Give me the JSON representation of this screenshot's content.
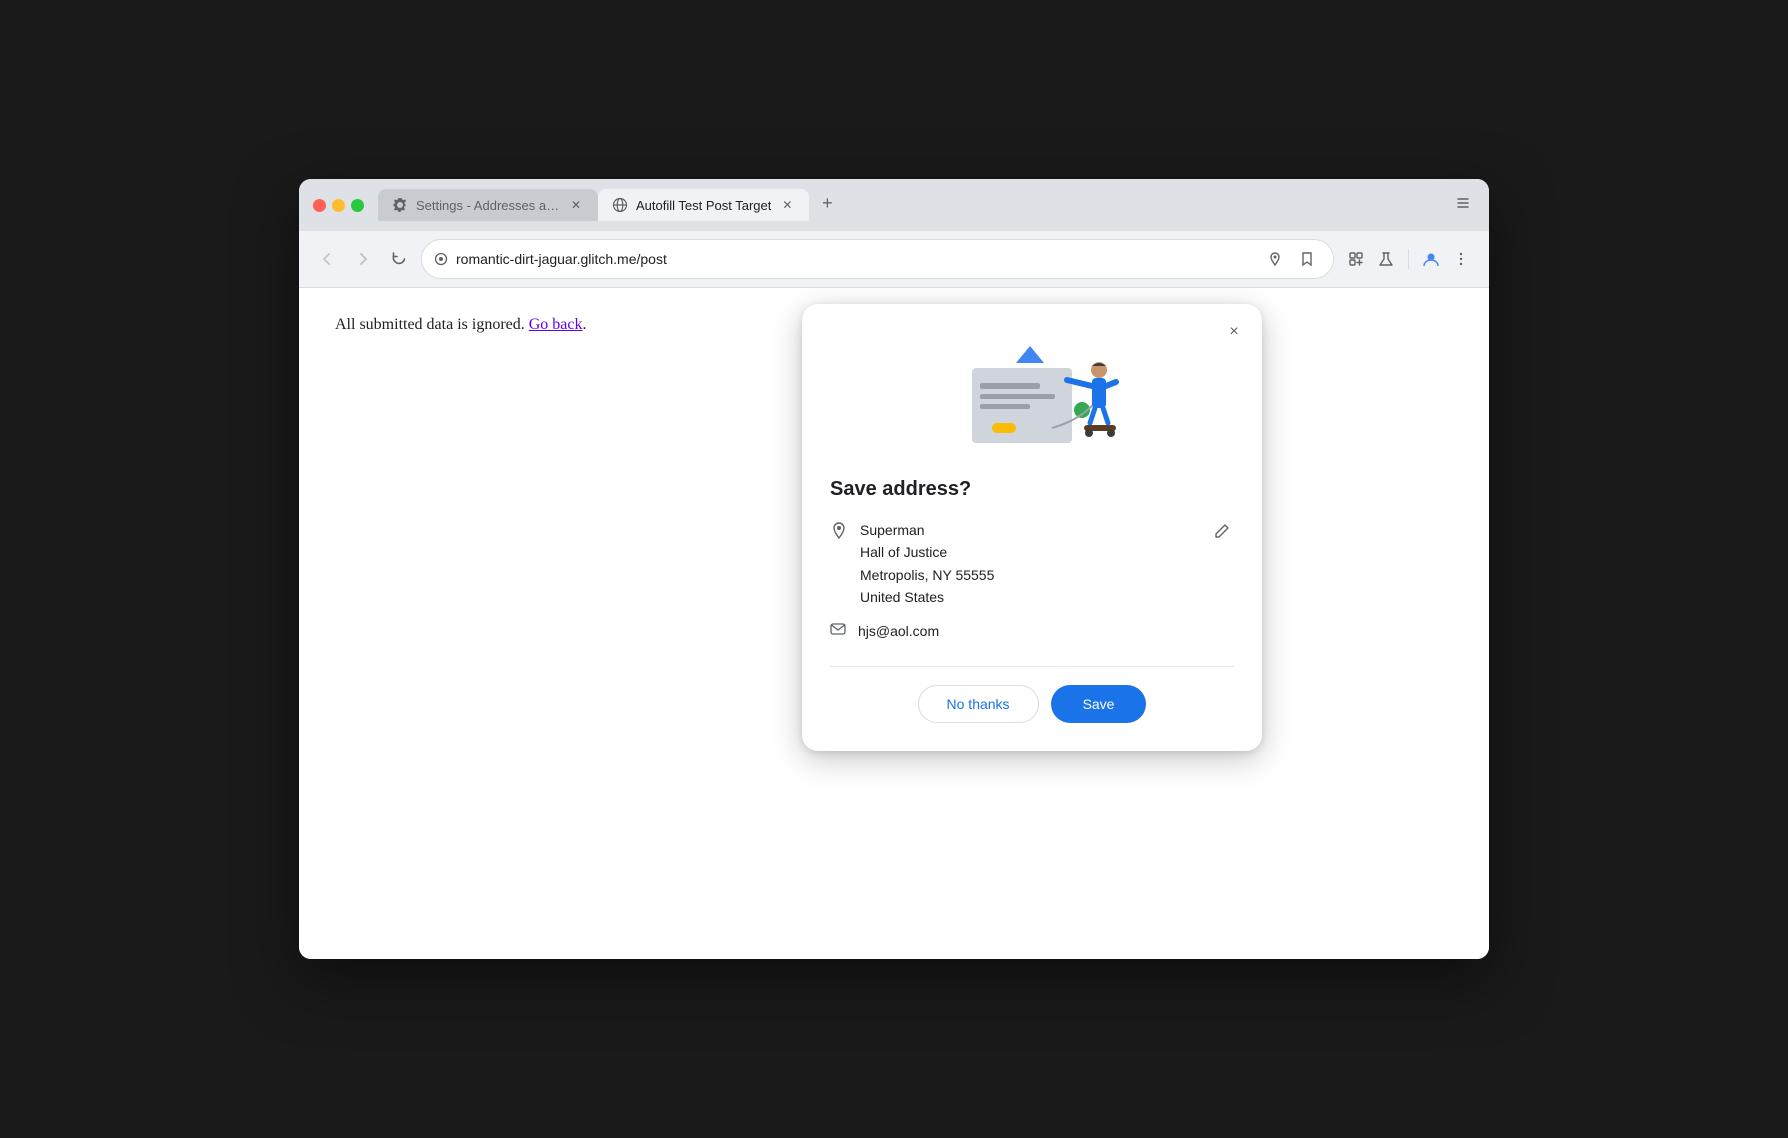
{
  "browser": {
    "tabs": [
      {
        "id": "settings-tab",
        "title": "Settings - Addresses and mo",
        "icon": "gear",
        "active": false
      },
      {
        "id": "autofill-tab",
        "title": "Autofill Test Post Target",
        "icon": "globe",
        "active": true
      }
    ],
    "url": "romantic-dirt-jaguar.glitch.me/post",
    "nav": {
      "back_disabled": false,
      "forward_disabled": false
    }
  },
  "page": {
    "body_text": "All submitted data is ignored.",
    "go_back_link": "Go back"
  },
  "dialog": {
    "title": "Save address?",
    "close_label": "×",
    "address": {
      "name": "Superman",
      "line2": "Hall of Justice",
      "line3": "Metropolis, NY 55555",
      "line4": "United States"
    },
    "email": "hjs@aol.com",
    "buttons": {
      "no_thanks": "No thanks",
      "save": "Save"
    }
  }
}
